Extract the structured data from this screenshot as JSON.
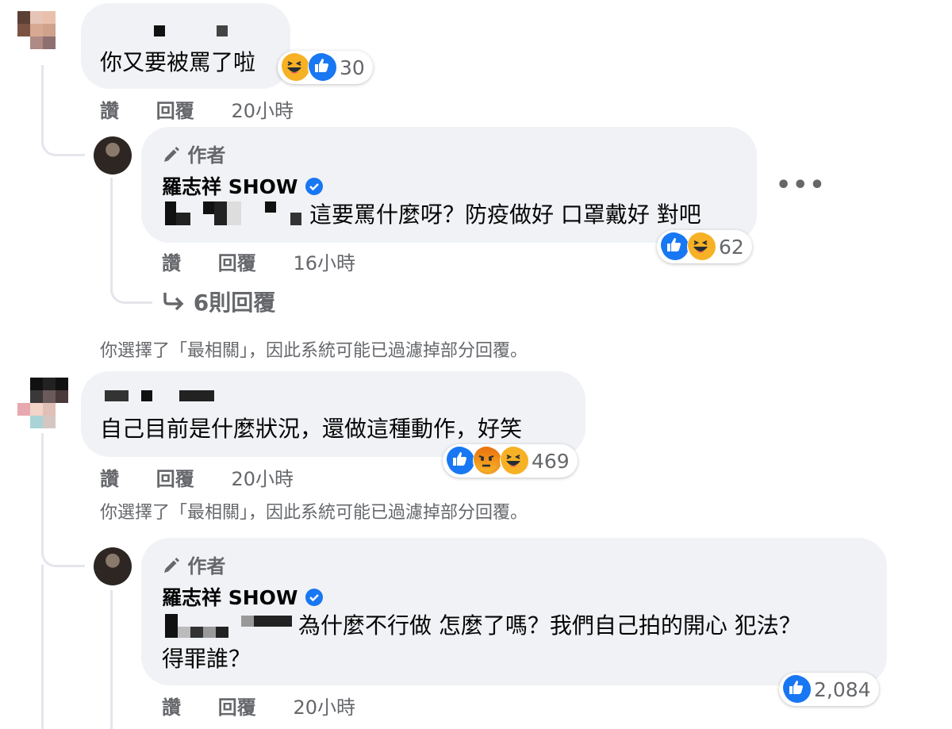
{
  "comments": [
    {
      "text": "你又要被罵了啦",
      "reaction_count": "30",
      "actions": {
        "like": "讚",
        "reply": "回覆",
        "time": "20小時"
      }
    },
    {
      "author_badge": "作者",
      "name": "羅志祥 SHOW",
      "text": "這要罵什麼呀？防疫做好 口罩戴好 對吧",
      "reaction_count": "62",
      "actions": {
        "like": "讚",
        "reply": "回覆",
        "time": "16小時"
      },
      "more_replies": "6則回覆"
    },
    {
      "text": "自己目前是什麼狀況，還做這種動作，好笑",
      "reaction_count": "469",
      "actions": {
        "like": "讚",
        "reply": "回覆",
        "time": "20小時"
      }
    },
    {
      "author_badge": "作者",
      "name": "羅志祥 SHOW",
      "text_line1": "為什麼不行做 怎麼了嗎？我們自己拍的開心 犯法？",
      "text_line2": "得罪誰？",
      "reaction_count": "2,084",
      "actions": {
        "like": "讚",
        "reply": "回覆",
        "time": "20小時"
      }
    }
  ],
  "filter_notice": "你選擇了「最相關」，因此系統可能已過濾掉部分回覆。",
  "icons": {
    "more": "more-options-icon",
    "reply_arrow": "reply-arrow-icon",
    "pen": "pen-icon",
    "verified": "verified-badge-icon"
  },
  "colors": {
    "like": "#1877f2",
    "haha": "#f7b125",
    "bubble": "#f0f2f5",
    "meta": "#65676b"
  }
}
